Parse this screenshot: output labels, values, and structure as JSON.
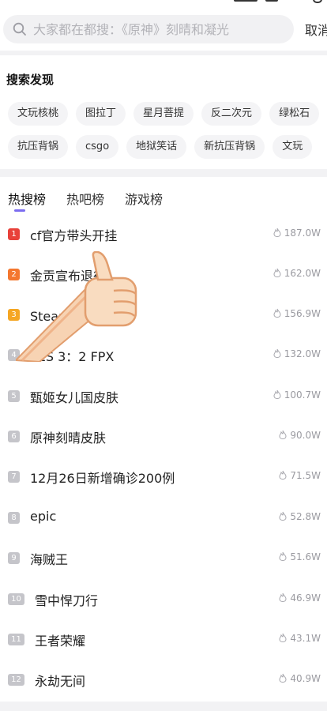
{
  "search": {
    "placeholder": "大家都在都搜：《原神》刻晴和凝光",
    "cancel_label": "取消"
  },
  "discover": {
    "title": "搜索发现",
    "row1": [
      "文玩核桃",
      "图拉丁",
      "星月菩提",
      "反二次元",
      "绿松石"
    ],
    "row2": [
      "抗压背锅",
      "csgo",
      "地狱笑话",
      "新抗压背锅",
      "文玩"
    ]
  },
  "tabs": [
    "热搜榜",
    "热吧榜",
    "游戏榜"
  ],
  "active_tab": "热搜榜",
  "colors": {
    "rank1": "#e8413a",
    "rank2": "#f4772f",
    "rank3": "#f5a623",
    "rank_other": "#c5c5ca",
    "accent": "#7b6cf0"
  },
  "list": [
    {
      "rank": "1",
      "title": "cf官方带头开挂",
      "heat": "187.0W"
    },
    {
      "rank": "2",
      "title": "金贡宣布退役",
      "heat": "162.0W"
    },
    {
      "rank": "3",
      "title": "Steam夏日榜",
      "heat": "156.9W"
    },
    {
      "rank": "4",
      "title": "TES 3：2 FPX",
      "heat": "132.0W"
    },
    {
      "rank": "5",
      "title": "甄姬女儿国皮肤",
      "heat": "100.7W"
    },
    {
      "rank": "6",
      "title": "原神刻晴皮肤",
      "heat": "90.0W"
    },
    {
      "rank": "7",
      "title": "12月26日新增确诊200例",
      "heat": "71.5W"
    },
    {
      "rank": "8",
      "title": "epic",
      "heat": "52.8W"
    },
    {
      "rank": "9",
      "title": "海贼王",
      "heat": "51.6W"
    },
    {
      "rank": "10",
      "title": "雪中悍刀行",
      "heat": "46.9W"
    },
    {
      "rank": "11",
      "title": "王者荣耀",
      "heat": "43.1W"
    },
    {
      "rank": "12",
      "title": "永劫无间",
      "heat": "40.9W"
    }
  ]
}
